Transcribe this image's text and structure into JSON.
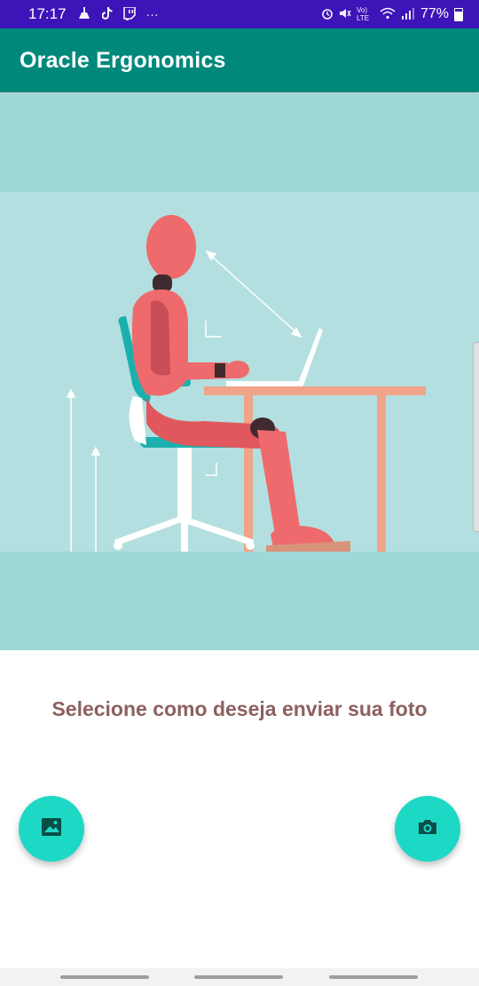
{
  "status_bar": {
    "time": "17:17",
    "notification_icons": [
      "cleaner-icon",
      "tiktok-icon",
      "twitch-icon",
      "more-icon"
    ],
    "more": "···",
    "network_text": "Vo) LTE",
    "battery_percent": "77%",
    "background": "#3d14b8"
  },
  "app_bar": {
    "title": "Oracle Ergonomics",
    "background": "#00897b"
  },
  "hero": {
    "background": "#9fd8d9",
    "illustration": "ergonomic-sitting-posture-illustration"
  },
  "main": {
    "prompt": "Selecione como deseja enviar sua foto",
    "prompt_color": "#8d6060"
  },
  "actions": {
    "gallery_icon": "image-icon",
    "camera_icon": "camera-icon",
    "fab_color": "#1ed8c6"
  }
}
